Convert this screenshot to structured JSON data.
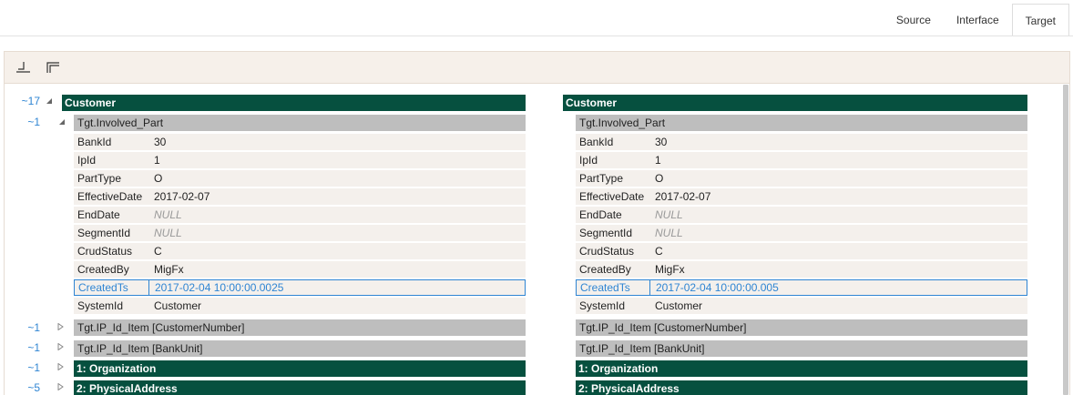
{
  "tabs": [
    {
      "label": "Source",
      "active": false
    },
    {
      "label": "Interface",
      "active": false
    },
    {
      "label": "Target",
      "active": true
    }
  ],
  "toolbar": {
    "icons": [
      "collapse-bottom-left-icon",
      "expand-top-left-icon"
    ]
  },
  "tree": {
    "diff_counts": {
      "customer": "~17",
      "involved_part": "~1",
      "ip_id_customer": "~1",
      "ip_id_bankunit": "~1",
      "organization": "~1",
      "physical_address": "~5"
    },
    "left": {
      "root": "Customer",
      "section": "Tgt.Involved_Part",
      "rows": [
        {
          "key": "BankId",
          "value": "30"
        },
        {
          "key": "IpId",
          "value": "1"
        },
        {
          "key": "PartType",
          "value": "O"
        },
        {
          "key": "EffectiveDate",
          "value": "2017-02-07"
        },
        {
          "key": "EndDate",
          "value": "NULL"
        },
        {
          "key": "SegmentId",
          "value": "NULL"
        },
        {
          "key": "CrudStatus",
          "value": "C"
        },
        {
          "key": "CreatedBy",
          "value": "MigFx"
        },
        {
          "key": "CreatedTs",
          "value": "2017-02-04 10:00:00.0025"
        },
        {
          "key": "SystemId",
          "value": "Customer"
        }
      ],
      "ip_id_customer": "Tgt.IP_Id_Item [CustomerNumber]",
      "ip_id_bankunit": "Tgt.IP_Id_Item [BankUnit]",
      "organization": "1: Organization",
      "physical_address": "2: PhysicalAddress"
    },
    "right": {
      "root": "Customer",
      "section": "Tgt.Involved_Part",
      "rows": [
        {
          "key": "BankId",
          "value": "30"
        },
        {
          "key": "IpId",
          "value": "1"
        },
        {
          "key": "PartType",
          "value": "O"
        },
        {
          "key": "EffectiveDate",
          "value": "2017-02-07"
        },
        {
          "key": "EndDate",
          "value": "NULL"
        },
        {
          "key": "SegmentId",
          "value": "NULL"
        },
        {
          "key": "CrudStatus",
          "value": "C"
        },
        {
          "key": "CreatedBy",
          "value": "MigFx"
        },
        {
          "key": "CreatedTs",
          "value": "2017-02-04 10:00:00.005"
        },
        {
          "key": "SystemId",
          "value": "Customer"
        }
      ],
      "ip_id_customer": "Tgt.IP_Id_Item [CustomerNumber]",
      "ip_id_bankunit": "Tgt.IP_Id_Item [BankUnit]",
      "organization": "1: Organization",
      "physical_address": "2: PhysicalAddress"
    }
  },
  "colors": {
    "dark_header": "#06503f",
    "grey_header": "#bebebe",
    "row_bg": "#f4f0ec",
    "diff_blue": "#2f85d3"
  }
}
